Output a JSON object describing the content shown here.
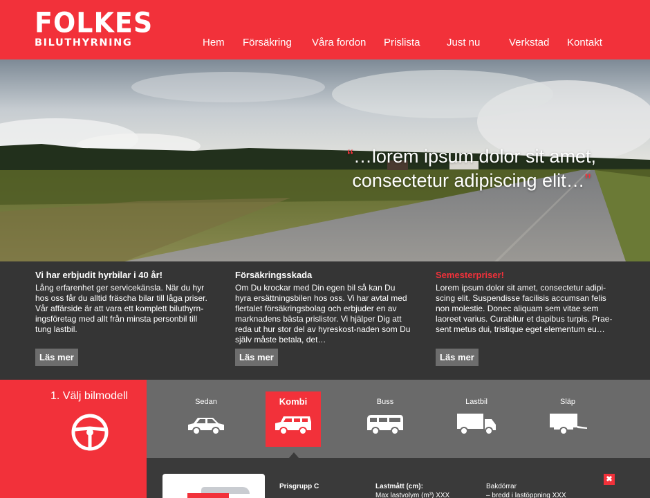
{
  "brand": {
    "name": "F🚗LKES",
    "name_text": "FOLKES",
    "tagline": "BILUTHYRNING"
  },
  "nav": [
    {
      "label": "Hem"
    },
    {
      "label": "Försäkring"
    },
    {
      "label": "Våra fordon"
    },
    {
      "label": "Prislista"
    },
    {
      "label": "Just nu"
    },
    {
      "label": "Verkstad"
    },
    {
      "label": "Kontakt"
    }
  ],
  "hero": {
    "quote_open": "“",
    "quote_text": "…lorem ipsum dolor sit amet, consectetur adipiscing elit…",
    "quote_close": "”"
  },
  "info": [
    {
      "title": "Vi har erbjudit hyrbilar i 40 år!",
      "body": "Lång erfarenhet ger servicekänsla. När du hyr hos oss får du alltid fräscha bilar till låga priser. Vår affärside är att vara ett komplett biluthyrn-ingsföretag med allt från minsta personbil till tung lastbil.",
      "button": "Läs mer"
    },
    {
      "title": "Försäkringsskada",
      "body": "Om Du krockar med Din egen bil så kan Du hyra ersättningsbilen hos oss. Vi har avtal med flertalet försäkringsbolag och erbjuder en av marknadens bästa prislistor. Vi hjälper Dig att reda ut hur stor del av hyreskost-naden som Du själv måste betala, det…",
      "button": "Läs mer"
    },
    {
      "title": "Semesterpriser!",
      "body": "Lorem ipsum dolor sit amet, consectetur adipi-scing elit. Suspendisse facilisis accumsan felis non molestie. Donec aliquam sem vitae sem laoreet varius. Curabitur et dapibus turpis. Prae-sent metus dui, tristique eget elementum eu…",
      "button": "Läs mer"
    }
  ],
  "selector": {
    "step_label": "1. Välj bilmodell",
    "vehicles": [
      {
        "label": "Sedan",
        "icon": "sedan-icon",
        "active": false
      },
      {
        "label": "Kombi",
        "icon": "station-wagon-icon",
        "active": true
      },
      {
        "label": "Buss",
        "icon": "bus-icon",
        "active": false
      },
      {
        "label": "Lastbil",
        "icon": "truck-icon",
        "active": false
      },
      {
        "label": "Släp",
        "icon": "trailer-icon",
        "active": false
      }
    ]
  },
  "detail": {
    "price_group": "Prisgrupp C",
    "cargo_title": "Lastmått (cm):",
    "cargo_line": "Max lastvolym (m³) XXX",
    "doors_title": "Bakdörrar",
    "doors_line": "– bredd i lastöppning XXX",
    "close": "✖"
  },
  "colors": {
    "brand_red": "#f2313a",
    "dark_band": "#353535",
    "selector_gray": "#6a6a6a",
    "button_gray": "#6d6d6d"
  }
}
